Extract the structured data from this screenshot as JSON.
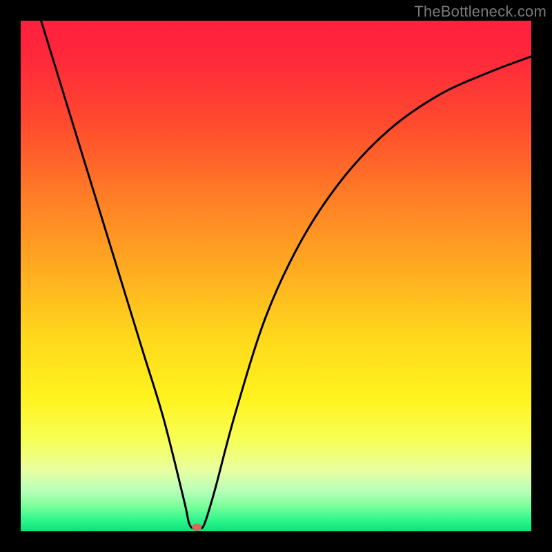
{
  "watermark": "TheBottleneck.com",
  "chart_data": {
    "type": "line",
    "title": "",
    "xlabel": "",
    "ylabel": "",
    "xlim": [
      0,
      100
    ],
    "ylim": [
      0,
      100
    ],
    "series": [
      {
        "name": "curve",
        "x": [
          4,
          8,
          12,
          16,
          20,
          24,
          28,
          32,
          33,
          34,
          35,
          36,
          38,
          42,
          48,
          55,
          63,
          72,
          82,
          92,
          100
        ],
        "y": [
          100,
          87,
          74,
          61,
          48,
          35,
          22,
          6,
          1.5,
          0.5,
          0.5,
          1.5,
          8,
          23,
          42,
          57,
          69,
          78.5,
          85.5,
          90,
          93
        ]
      }
    ],
    "marker": {
      "x": 34.5,
      "y": 0.8,
      "color": "#d46a5e"
    },
    "colors": {
      "gradient_top": "#ff1f3e",
      "gradient_mid": "#ffd81c",
      "gradient_bottom": "#0fe07c",
      "curve": "#000000",
      "frame": "#000000"
    }
  }
}
